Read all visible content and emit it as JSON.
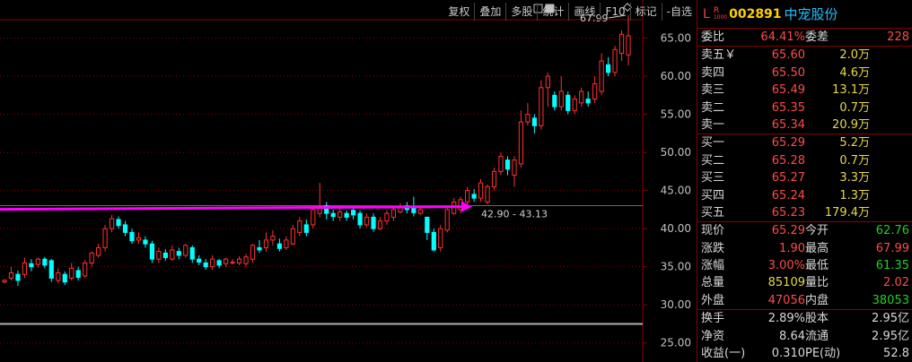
{
  "toolbar": [
    "复权",
    "叠加",
    "多股",
    "统计",
    "画线",
    "F10",
    "标记",
    "-自选"
  ],
  "header": {
    "code": "002891",
    "name": "中宠股份",
    "mark": "L",
    "mark_r": "R",
    "mark_sub": "1000"
  },
  "committee": {
    "ratio_label": "委比",
    "ratio": "64.41%",
    "diff_label": "委差",
    "diff": "228"
  },
  "asks": [
    {
      "label": "卖五￥",
      "price": "65.60",
      "vol": "2.0万"
    },
    {
      "label": "卖四",
      "price": "65.50",
      "vol": "4.6万"
    },
    {
      "label": "卖三",
      "price": "65.49",
      "vol": "13.1万"
    },
    {
      "label": "卖二",
      "price": "65.35",
      "vol": "0.7万"
    },
    {
      "label": "卖一",
      "price": "65.34",
      "vol": "20.9万"
    }
  ],
  "bids": [
    {
      "label": "买一",
      "price": "65.29",
      "vol": "5.2万"
    },
    {
      "label": "买二",
      "price": "65.28",
      "vol": "0.7万"
    },
    {
      "label": "买三",
      "price": "65.27",
      "vol": "3.3万"
    },
    {
      "label": "买四",
      "price": "65.24",
      "vol": "1.3万"
    },
    {
      "label": "买五",
      "price": "65.23",
      "vol": "179.4万"
    }
  ],
  "quote": [
    {
      "l1": "现价",
      "v1": "65.29",
      "c1": "red",
      "l2": "今开",
      "v2": "62.76",
      "c2": "green"
    },
    {
      "l1": "涨跌",
      "v1": "1.90",
      "c1": "red",
      "l2": "最高",
      "v2": "67.99",
      "c2": "red"
    },
    {
      "l1": "涨幅",
      "v1": "3.00%",
      "c1": "red",
      "l2": "最低",
      "v2": "61.35",
      "c2": "green"
    },
    {
      "l1": "总量",
      "v1": "85109",
      "c1": "yellow",
      "l2": "量比",
      "v2": "2.02",
      "c2": "red"
    },
    {
      "l1": "外盘",
      "v1": "47056",
      "c1": "red",
      "l2": "内盘",
      "v2": "38053",
      "c2": "green"
    }
  ],
  "fundamentals": [
    {
      "l1": "换手",
      "v1": "2.89%",
      "l2": "股本",
      "v2": "2.95亿"
    },
    {
      "l1": "净资",
      "v1": "8.64",
      "l2": "流通",
      "v2": "2.95亿"
    },
    {
      "l1": "收益(一)",
      "v1": "0.310",
      "l2": "PE(动)",
      "v2": "52.8"
    }
  ],
  "colors": {
    "up": "#ff3030",
    "down": "#00ffff",
    "trend": "#ff00ff",
    "grid": "#8b0000",
    "axis_text": "#c0c0c0"
  },
  "chart_data": {
    "type": "candlestick",
    "ylim": [
      22.5,
      70
    ],
    "yticks": [
      25,
      30,
      35,
      40,
      45,
      50,
      55,
      60,
      65
    ],
    "high_label": "67.99",
    "range_label": "42.90 - 43.13",
    "support_line": 43.0,
    "low_line": 27.5,
    "candles": [
      {
        "o": 33.0,
        "c": 33.2,
        "h": 33.4,
        "l": 32.8
      },
      {
        "o": 33.5,
        "c": 34.2,
        "h": 35.0,
        "l": 33.2
      },
      {
        "o": 34.0,
        "c": 33.2,
        "h": 34.5,
        "l": 32.5
      },
      {
        "o": 34.0,
        "c": 35.5,
        "h": 36.2,
        "l": 33.5
      },
      {
        "o": 35.4,
        "c": 35.0,
        "h": 36.0,
        "l": 34.4
      },
      {
        "o": 35.3,
        "c": 36.0,
        "h": 36.2,
        "l": 34.9
      },
      {
        "o": 36.0,
        "c": 35.2,
        "h": 36.3,
        "l": 34.8
      },
      {
        "o": 35.8,
        "c": 33.5,
        "h": 36.0,
        "l": 33.0
      },
      {
        "o": 33.2,
        "c": 34.2,
        "h": 34.8,
        "l": 32.8
      },
      {
        "o": 34.0,
        "c": 33.0,
        "h": 34.4,
        "l": 32.6
      },
      {
        "o": 33.5,
        "c": 34.8,
        "h": 35.5,
        "l": 33.2
      },
      {
        "o": 34.5,
        "c": 33.6,
        "h": 35.0,
        "l": 33.2
      },
      {
        "o": 33.8,
        "c": 35.5,
        "h": 35.9,
        "l": 33.5
      },
      {
        "o": 35.5,
        "c": 36.8,
        "h": 37.0,
        "l": 35.0
      },
      {
        "o": 36.5,
        "c": 37.5,
        "h": 38.0,
        "l": 36.2
      },
      {
        "o": 37.5,
        "c": 40.0,
        "h": 40.5,
        "l": 37.0
      },
      {
        "o": 40.0,
        "c": 41.3,
        "h": 41.8,
        "l": 39.5
      },
      {
        "o": 41.2,
        "c": 40.4,
        "h": 41.6,
        "l": 40.0
      },
      {
        "o": 40.5,
        "c": 39.5,
        "h": 41.0,
        "l": 39.0
      },
      {
        "o": 39.5,
        "c": 38.4,
        "h": 40.0,
        "l": 38.0
      },
      {
        "o": 38.5,
        "c": 38.8,
        "h": 39.5,
        "l": 38.0
      },
      {
        "o": 38.5,
        "c": 38.0,
        "h": 39.0,
        "l": 37.5
      },
      {
        "o": 38.0,
        "c": 36.0,
        "h": 38.4,
        "l": 35.5
      },
      {
        "o": 36.0,
        "c": 37.0,
        "h": 37.5,
        "l": 35.5
      },
      {
        "o": 36.8,
        "c": 36.2,
        "h": 37.3,
        "l": 35.8
      },
      {
        "o": 36.0,
        "c": 37.2,
        "h": 37.8,
        "l": 35.8
      },
      {
        "o": 37.0,
        "c": 36.5,
        "h": 37.5,
        "l": 36.0
      },
      {
        "o": 36.5,
        "c": 37.8,
        "h": 38.0,
        "l": 36.2
      },
      {
        "o": 37.5,
        "c": 36.0,
        "h": 37.8,
        "l": 35.5
      },
      {
        "o": 36.0,
        "c": 35.6,
        "h": 36.5,
        "l": 35.2
      },
      {
        "o": 35.5,
        "c": 35.0,
        "h": 36.0,
        "l": 34.6
      },
      {
        "o": 35.0,
        "c": 36.0,
        "h": 36.5,
        "l": 34.6
      },
      {
        "o": 35.8,
        "c": 35.2,
        "h": 36.0,
        "l": 34.8
      },
      {
        "o": 35.4,
        "c": 36.0,
        "h": 36.2,
        "l": 35.0
      },
      {
        "o": 35.6,
        "c": 35.6,
        "h": 36.0,
        "l": 35.3
      },
      {
        "o": 35.5,
        "c": 36.0,
        "h": 36.4,
        "l": 35.2
      },
      {
        "o": 35.4,
        "c": 36.3,
        "h": 36.7,
        "l": 35.0
      },
      {
        "o": 36.0,
        "c": 37.8,
        "h": 38.0,
        "l": 35.6
      },
      {
        "o": 37.5,
        "c": 37.2,
        "h": 38.5,
        "l": 36.8
      },
      {
        "o": 37.5,
        "c": 38.5,
        "h": 39.5,
        "l": 37.0
      },
      {
        "o": 38.5,
        "c": 39.0,
        "h": 39.8,
        "l": 37.8
      },
      {
        "o": 38.0,
        "c": 37.4,
        "h": 38.7,
        "l": 37.0
      },
      {
        "o": 37.5,
        "c": 38.5,
        "h": 39.0,
        "l": 37.2
      },
      {
        "o": 38.0,
        "c": 40.0,
        "h": 40.5,
        "l": 37.8
      },
      {
        "o": 39.5,
        "c": 41.0,
        "h": 41.5,
        "l": 39.0
      },
      {
        "o": 40.5,
        "c": 39.5,
        "h": 41.2,
        "l": 39.0
      },
      {
        "o": 40.5,
        "c": 42.5,
        "h": 43.0,
        "l": 40.0
      },
      {
        "o": 42.0,
        "c": 43.0,
        "h": 46.0,
        "l": 41.5
      },
      {
        "o": 43.0,
        "c": 42.0,
        "h": 43.5,
        "l": 41.2
      },
      {
        "o": 42.0,
        "c": 41.6,
        "h": 42.5,
        "l": 41.0
      },
      {
        "o": 41.5,
        "c": 42.2,
        "h": 42.8,
        "l": 41.0
      },
      {
        "o": 42.0,
        "c": 41.5,
        "h": 42.4,
        "l": 41.0
      },
      {
        "o": 42.4,
        "c": 41.8,
        "h": 42.8,
        "l": 41.2
      },
      {
        "o": 42.0,
        "c": 40.5,
        "h": 42.4,
        "l": 40.0
      },
      {
        "o": 40.5,
        "c": 41.5,
        "h": 42.0,
        "l": 40.2
      },
      {
        "o": 41.5,
        "c": 40.0,
        "h": 42.0,
        "l": 39.6
      },
      {
        "o": 40.0,
        "c": 41.0,
        "h": 41.5,
        "l": 39.8
      },
      {
        "o": 41.0,
        "c": 42.0,
        "h": 42.4,
        "l": 40.5
      },
      {
        "o": 41.5,
        "c": 42.5,
        "h": 43.0,
        "l": 41.0
      },
      {
        "o": 42.2,
        "c": 42.8,
        "h": 43.3,
        "l": 42.0
      },
      {
        "o": 43.0,
        "c": 42.5,
        "h": 43.5,
        "l": 42.0
      },
      {
        "o": 42.8,
        "c": 42.1,
        "h": 44.2,
        "l": 41.6
      },
      {
        "o": 42.0,
        "c": 42.5,
        "h": 42.8,
        "l": 41.8
      },
      {
        "o": 41.5,
        "c": 39.5,
        "h": 41.5,
        "l": 38.5
      },
      {
        "o": 39.5,
        "c": 37.2,
        "h": 40.0,
        "l": 37.0
      },
      {
        "o": 37.5,
        "c": 40.0,
        "h": 40.5,
        "l": 37.0
      },
      {
        "o": 39.8,
        "c": 42.5,
        "h": 43.0,
        "l": 39.5
      },
      {
        "o": 42.0,
        "c": 43.5,
        "h": 44.0,
        "l": 41.8
      },
      {
        "o": 42.5,
        "c": 43.8,
        "h": 44.2,
        "l": 42.0
      },
      {
        "o": 43.5,
        "c": 45.0,
        "h": 45.5,
        "l": 43.0
      },
      {
        "o": 44.5,
        "c": 44.0,
        "h": 45.2,
        "l": 43.5
      },
      {
        "o": 44.0,
        "c": 46.0,
        "h": 46.5,
        "l": 43.5
      },
      {
        "o": 43.5,
        "c": 45.5,
        "h": 45.8,
        "l": 43.2
      },
      {
        "o": 45.5,
        "c": 47.5,
        "h": 48.0,
        "l": 45.0
      },
      {
        "o": 47.5,
        "c": 49.5,
        "h": 50.0,
        "l": 47.0
      },
      {
        "o": 49.0,
        "c": 47.8,
        "h": 49.5,
        "l": 47.0
      },
      {
        "o": 47.0,
        "c": 49.0,
        "h": 49.5,
        "l": 45.5
      },
      {
        "o": 48.5,
        "c": 54.0,
        "h": 55.5,
        "l": 48.0
      },
      {
        "o": 54.0,
        "c": 55.0,
        "h": 56.5,
        "l": 53.5
      },
      {
        "o": 54.5,
        "c": 53.5,
        "h": 55.0,
        "l": 52.5
      },
      {
        "o": 53.5,
        "c": 58.5,
        "h": 59.5,
        "l": 53.0
      },
      {
        "o": 58.5,
        "c": 60.0,
        "h": 60.5,
        "l": 56.0
      },
      {
        "o": 57.5,
        "c": 56.0,
        "h": 58.0,
        "l": 55.5
      },
      {
        "o": 56.0,
        "c": 58.0,
        "h": 60.0,
        "l": 55.5
      },
      {
        "o": 57.5,
        "c": 55.5,
        "h": 58.0,
        "l": 55.0
      },
      {
        "o": 55.5,
        "c": 57.0,
        "h": 57.5,
        "l": 55.0
      },
      {
        "o": 56.5,
        "c": 58.0,
        "h": 58.5,
        "l": 56.0
      },
      {
        "o": 57.0,
        "c": 56.5,
        "h": 58.0,
        "l": 56.0
      },
      {
        "o": 57.0,
        "c": 59.0,
        "h": 60.0,
        "l": 56.5
      },
      {
        "o": 58.0,
        "c": 62.0,
        "h": 63.0,
        "l": 57.5
      },
      {
        "o": 61.5,
        "c": 60.5,
        "h": 62.5,
        "l": 60.0
      },
      {
        "o": 60.5,
        "c": 63.5,
        "h": 64.0,
        "l": 60.0
      },
      {
        "o": 63.0,
        "c": 65.5,
        "h": 66.0,
        "l": 62.0
      },
      {
        "o": 62.8,
        "c": 65.3,
        "h": 68.0,
        "l": 61.4
      }
    ]
  }
}
